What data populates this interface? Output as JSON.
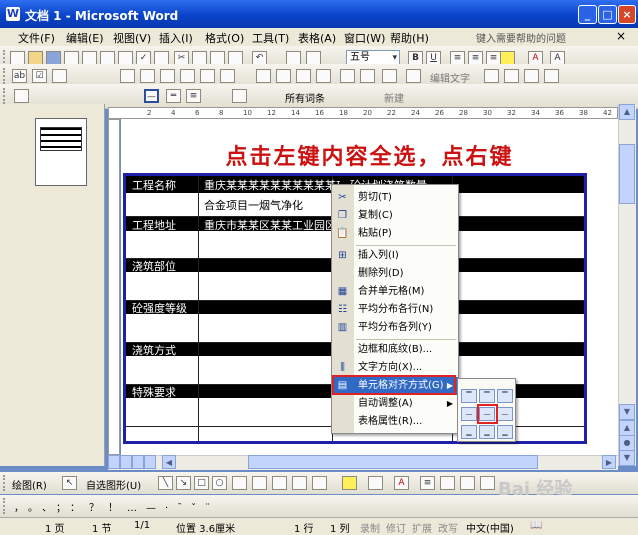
{
  "window": {
    "title": "文档 1 - Microsoft Word",
    "app_icon": "W"
  },
  "menubar": {
    "items": [
      "文件(F)",
      "编辑(E)",
      "视图(V)",
      "插入(I)",
      "格式(O)",
      "工具(T)",
      "表格(A)",
      "窗口(W)",
      "帮助(H)"
    ],
    "help_placeholder": "键入需要帮助的问题",
    "close_doc": "×"
  },
  "toolbar_formatting": {
    "font_size": "五号"
  },
  "toolbar_standard": {
    "edit_text": "编辑文字"
  },
  "toolbar_review": {
    "show_label": "所有词条",
    "new_label": "新建"
  },
  "ruler_numbers": [
    "2",
    "4",
    "6",
    "8",
    "10",
    "12",
    "14",
    "16",
    "18",
    "20",
    "22",
    "24",
    "26",
    "28",
    "30",
    "32",
    "34",
    "36",
    "38",
    "42"
  ],
  "document": {
    "heading": "点击左键内容全选，点右键",
    "rows": [
      {
        "label": "工程名称",
        "value": "重庆某某某某某某某某某某项目",
        "value2": "合金项目一烟气净化",
        "extra": "砼计划浇筑数量"
      },
      {
        "label": "工程地址",
        "value": "重庆市某某区某某工业园区"
      },
      {
        "label": "浇筑部位"
      },
      {
        "label": "砼强度等级"
      },
      {
        "label": "浇筑方式"
      },
      {
        "label": "特殊要求"
      }
    ]
  },
  "context_menu": {
    "items": [
      {
        "label": "剪切(T)",
        "icon": "scissors-icon"
      },
      {
        "label": "复制(C)",
        "icon": "copy-icon"
      },
      {
        "label": "粘贴(P)",
        "icon": "paste-icon"
      },
      {
        "label": "插入列(I)",
        "icon": "insert-column-icon"
      },
      {
        "label": "删除列(D)",
        "icon": ""
      },
      {
        "label": "合并单元格(M)",
        "icon": "merge-cells-icon"
      },
      {
        "label": "平均分布各行(N)",
        "icon": "distribute-rows-icon"
      },
      {
        "label": "平均分布各列(Y)",
        "icon": "distribute-columns-icon"
      },
      {
        "label": "边框和底纹(B)...",
        "icon": ""
      },
      {
        "label": "文字方向(X)...",
        "icon": "text-direction-icon"
      },
      {
        "label": "单元格对齐方式(G)",
        "icon": "cell-align-icon",
        "selected": true,
        "submenu": true
      },
      {
        "label": "自动调整(A)",
        "icon": "",
        "submenu": true
      },
      {
        "label": "表格属性(R)...",
        "icon": ""
      }
    ]
  },
  "drawing_toolbar": {
    "draw_label": "绘图(R)",
    "autoshape_label": "自选图形(U)"
  },
  "statusbar": {
    "page": "1 页",
    "section": "1 节",
    "pages": "1/1",
    "position": "位置 3.6厘米",
    "line": "1 行",
    "column": "1 列",
    "rec": "录制",
    "trk": "修订",
    "ext": "扩展",
    "ovr": "改写",
    "language": "中文(中国)"
  },
  "watermark": "Bai 经验",
  "colors": {
    "heading": "#cc1111",
    "table_border": "#1f1fa8",
    "selection": "#316ac5",
    "highlight_box": "#e22222"
  }
}
